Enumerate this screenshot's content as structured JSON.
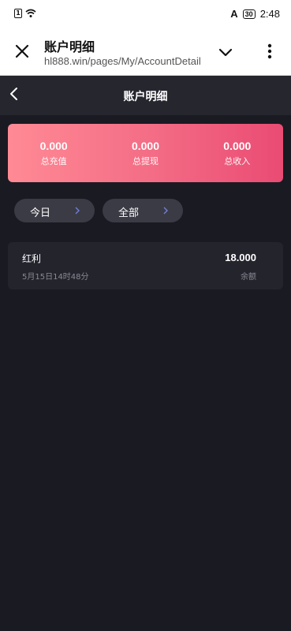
{
  "status_bar": {
    "time": "2:48",
    "battery": "30",
    "network_badge": "1",
    "carrier_icon": "A"
  },
  "browser": {
    "title": "账户明细",
    "url": "hl888.win/pages/My/AccountDetail"
  },
  "header": {
    "title": "账户明细"
  },
  "summary": [
    {
      "value": "0.000",
      "label": "总充值"
    },
    {
      "value": "0.000",
      "label": "总提现"
    },
    {
      "value": "0.000",
      "label": "总收入"
    }
  ],
  "filters": {
    "date": "今日",
    "type": "全部"
  },
  "records": [
    {
      "name": "红利",
      "time": "5月15日14时48分",
      "amount": "18.000",
      "note": "余额"
    }
  ],
  "colors": {
    "accent_start": "#ff8a95",
    "accent_end": "#ea4b73",
    "background": "#1a1a22"
  }
}
